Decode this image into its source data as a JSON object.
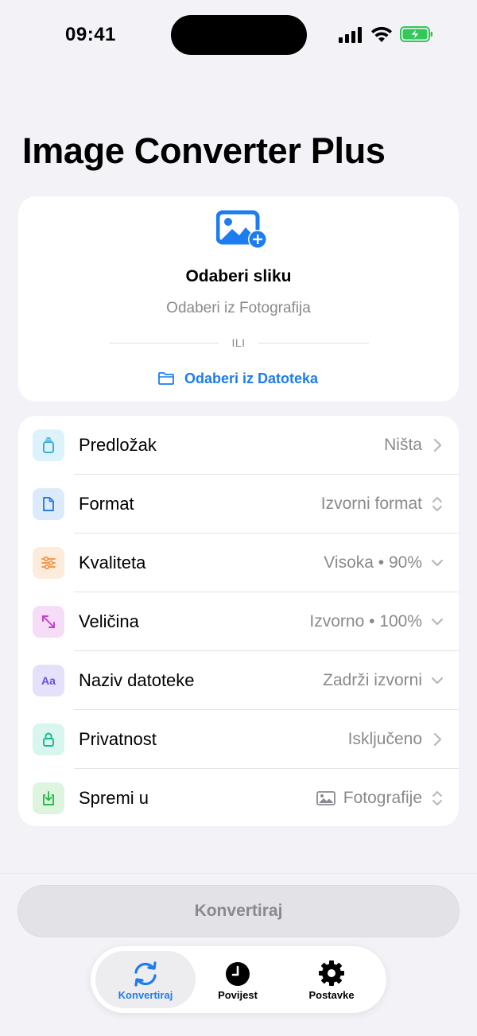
{
  "status_bar": {
    "time": "09:41"
  },
  "page": {
    "title": "Image Converter Plus"
  },
  "picker": {
    "title": "Odaberi sliku",
    "subtitle": "Odaberi iz Fotografija",
    "or_label": "ILI",
    "files_label": "Odaberi iz Datoteka"
  },
  "settings": {
    "rows": [
      {
        "label": "Predložak",
        "value": "Ništa",
        "icon": "template-icon",
        "accessory": "chevron-right"
      },
      {
        "label": "Format",
        "value": "Izvorni format",
        "icon": "document-icon",
        "accessory": "chevron-updown"
      },
      {
        "label": "Kvaliteta",
        "value": "Visoka • 90%",
        "icon": "sliders-icon",
        "accessory": "chevron-down"
      },
      {
        "label": "Veličina",
        "value": "Izvorno • 100%",
        "icon": "resize-arrows-icon",
        "accessory": "chevron-down"
      },
      {
        "label": "Naziv datoteke",
        "value": "Zadrži izvorni",
        "icon": "text-aa-icon",
        "accessory": "chevron-down"
      },
      {
        "label": "Privatnost",
        "value": "Isključeno",
        "icon": "lock-icon",
        "accessory": "chevron-right"
      },
      {
        "label": "Spremi u",
        "value": "Fotografije",
        "icon": "save-download-icon",
        "accessory": "chevron-updown"
      }
    ]
  },
  "convert_button": {
    "label": "Konvertiraj"
  },
  "tab_bar": {
    "tabs": [
      {
        "label": "Konvertiraj",
        "icon": "convert-arrows-icon",
        "active": true
      },
      {
        "label": "Povijest",
        "icon": "clock-icon",
        "active": false
      },
      {
        "label": "Postavke",
        "icon": "gear-icon",
        "active": false
      }
    ]
  },
  "colors": {
    "accent": "#1C7CF0",
    "background": "#F2F2F7",
    "secondary_text": "#8A8A8E",
    "battery_green": "#34C759"
  }
}
